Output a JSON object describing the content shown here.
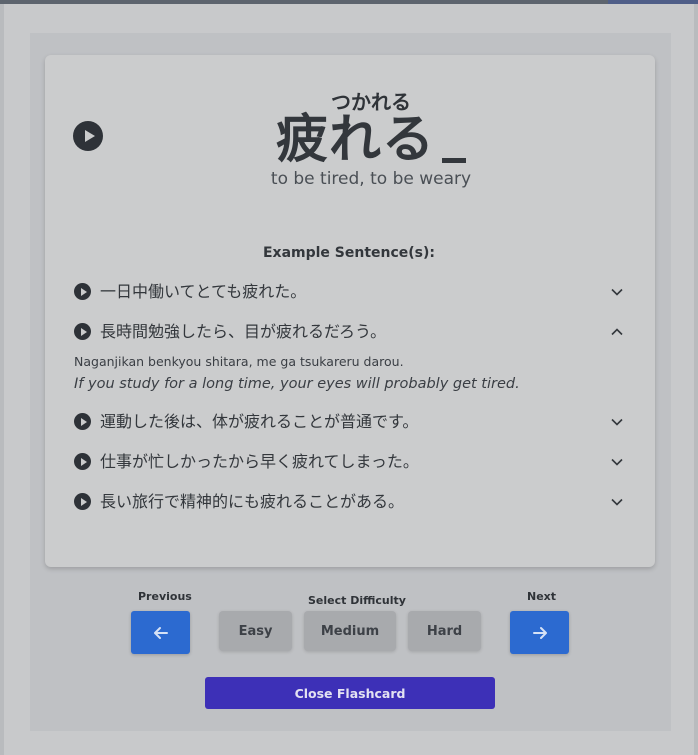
{
  "flashcard": {
    "reading": "つかれる",
    "kanji": "疲れる",
    "meaning": "to be tired, to be weary"
  },
  "examples": {
    "title": "Example Sentence(s):",
    "items": [
      {
        "text": "一日中働いてとても疲れた。",
        "expanded": false
      },
      {
        "text": "長時間勉強したら、目が疲れるだろう。",
        "expanded": true,
        "romaji": "Naganjikan benkyou shitara, me ga tsukareru darou.",
        "translation": "If you study for a long time, your eyes will probably get tired."
      },
      {
        "text": "運動した後は、体が疲れることが普通です。",
        "expanded": false
      },
      {
        "text": "仕事が忙しかったから早く疲れてしまった。",
        "expanded": false
      },
      {
        "text": "長い旅行で精神的にも疲れることがある。",
        "expanded": false
      }
    ]
  },
  "controls": {
    "previous_label": "Previous",
    "next_label": "Next",
    "difficulty_label": "Select Difficulty",
    "difficulties": [
      "Easy",
      "Medium",
      "Hard"
    ],
    "close_label": "Close Flashcard"
  },
  "icons": {
    "audio": "play-icon",
    "collapse": "chevron-down-icon",
    "expand": "chevron-up-icon",
    "previous": "arrow-left-icon",
    "next": "arrow-right-icon"
  },
  "colors": {
    "nav_button": "#2c6ad0",
    "close_button": "#3d30b7",
    "difficulty_button": "#a8aaad"
  }
}
